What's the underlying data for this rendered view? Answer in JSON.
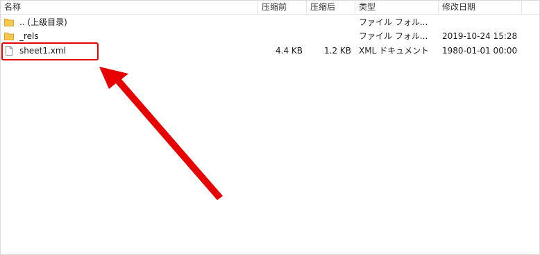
{
  "columns": {
    "name": "名称",
    "compressed_before": "压缩前",
    "compressed_after": "压缩后",
    "type": "类型",
    "modified": "修改日期"
  },
  "files": [
    {
      "name": ".. (上级目录)",
      "size_before": "",
      "size_after": "",
      "type": "ファイル フォル...",
      "modified": "",
      "icon": "folder-icon"
    },
    {
      "name": "_rels",
      "size_before": "",
      "size_after": "",
      "type": "ファイル フォル...",
      "modified": "2019-10-24 15:28",
      "icon": "folder-icon"
    },
    {
      "name": "sheet1.xml",
      "size_before": "4.4 KB",
      "size_after": "1.2 KB",
      "type": "XML ドキュメント",
      "modified": "1980-01-01 00:00",
      "icon": "file-icon"
    }
  ],
  "colors": {
    "annotation": "#e60000",
    "folder": "#f6c94c",
    "divider": "#e5e5e5"
  }
}
